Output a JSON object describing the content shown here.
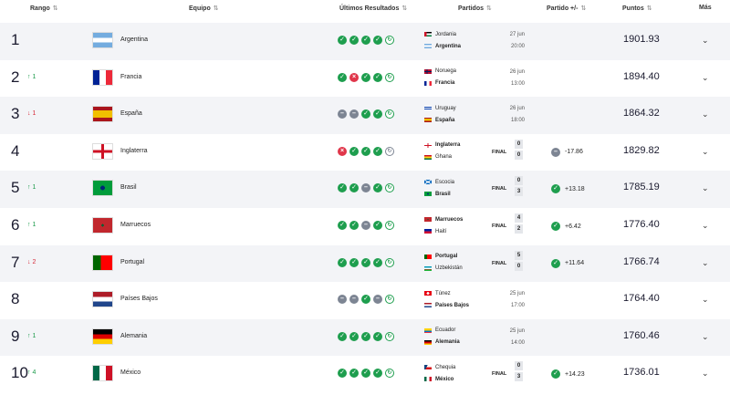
{
  "header": {
    "rank": "Rango",
    "team": "Equipo",
    "results": "Últimos Resultados",
    "matches": "Partidos",
    "delta": "Partido +/-",
    "points": "Puntos",
    "more": "Más",
    "sort_icon": "⇅"
  },
  "more_icon": "⌄",
  "rows": [
    {
      "rank": "1",
      "move": "",
      "dir": "",
      "team": "Argentina",
      "flag": "argentina",
      "results": [
        "W",
        "W",
        "W",
        "W",
        "N"
      ],
      "m1": {
        "name": "Jordania",
        "flag": "jordan",
        "bold": false
      },
      "m2": {
        "name": "Argentina",
        "flag": "argentina",
        "bold": true
      },
      "date": "27 jun",
      "time": "20:00",
      "final": "",
      "s1": "",
      "s2": "",
      "delta": "",
      "delta_type": "",
      "points": "1901.93"
    },
    {
      "rank": "2",
      "move": "↑ 1",
      "dir": "up",
      "team": "Francia",
      "flag": "france",
      "results": [
        "W",
        "L",
        "W",
        "W",
        "N"
      ],
      "m1": {
        "name": "Noruega",
        "flag": "norway",
        "bold": false
      },
      "m2": {
        "name": "Francia",
        "flag": "france",
        "bold": true
      },
      "date": "26 jun",
      "time": "13:00",
      "final": "",
      "s1": "",
      "s2": "",
      "delta": "",
      "delta_type": "",
      "points": "1894.40"
    },
    {
      "rank": "3",
      "move": "↓ 1",
      "dir": "down",
      "team": "España",
      "flag": "spain",
      "results": [
        "D",
        "D",
        "W",
        "W",
        "N"
      ],
      "m1": {
        "name": "Uruguay",
        "flag": "uruguay",
        "bold": false
      },
      "m2": {
        "name": "España",
        "flag": "spain",
        "bold": true
      },
      "date": "26 jun",
      "time": "18:00",
      "final": "",
      "s1": "",
      "s2": "",
      "delta": "",
      "delta_type": "",
      "points": "1864.32"
    },
    {
      "rank": "4",
      "move": "",
      "dir": "",
      "team": "Inglaterra",
      "flag": "england",
      "results": [
        "L",
        "W",
        "W",
        "W",
        "NG"
      ],
      "m1": {
        "name": "Inglaterra",
        "flag": "england",
        "bold": true
      },
      "m2": {
        "name": "Ghana",
        "flag": "ghana",
        "bold": false
      },
      "date": "",
      "time": "",
      "final": "FINAL",
      "s1": "0",
      "s2": "0",
      "delta": "-17.86",
      "delta_type": "D",
      "points": "1829.82"
    },
    {
      "rank": "5",
      "move": "↑ 1",
      "dir": "up",
      "team": "Brasil",
      "flag": "brazil",
      "results": [
        "W",
        "W",
        "D",
        "W",
        "N"
      ],
      "m1": {
        "name": "Escocia",
        "flag": "scotland",
        "bold": false
      },
      "m2": {
        "name": "Brasil",
        "flag": "brazil",
        "bold": true
      },
      "date": "",
      "time": "",
      "final": "FINAL",
      "s1": "0",
      "s2": "3",
      "delta": "+13.18",
      "delta_type": "W",
      "points": "1785.19"
    },
    {
      "rank": "6",
      "move": "↑ 1",
      "dir": "up",
      "team": "Marruecos",
      "flag": "morocco",
      "results": [
        "W",
        "W",
        "D",
        "W",
        "N"
      ],
      "m1": {
        "name": "Marruecos",
        "flag": "morocco",
        "bold": true
      },
      "m2": {
        "name": "Haití",
        "flag": "haiti",
        "bold": false
      },
      "date": "",
      "time": "",
      "final": "FINAL",
      "s1": "4",
      "s2": "2",
      "delta": "+6.42",
      "delta_type": "W",
      "points": "1776.40"
    },
    {
      "rank": "7",
      "move": "↓ 2",
      "dir": "down",
      "team": "Portugal",
      "flag": "portugal",
      "results": [
        "W",
        "W",
        "W",
        "W",
        "N"
      ],
      "m1": {
        "name": "Portugal",
        "flag": "portugal",
        "bold": true
      },
      "m2": {
        "name": "Uzbekistán",
        "flag": "uzbekistan",
        "bold": false
      },
      "date": "",
      "time": "",
      "final": "FINAL",
      "s1": "5",
      "s2": "0",
      "delta": "+11.64",
      "delta_type": "W",
      "points": "1766.74"
    },
    {
      "rank": "8",
      "move": "",
      "dir": "",
      "team": "Países Bajos",
      "flag": "netherlands",
      "results": [
        "D",
        "D",
        "W",
        "D",
        "N"
      ],
      "m1": {
        "name": "Túnez",
        "flag": "tunisia",
        "bold": false
      },
      "m2": {
        "name": "Países Bajos",
        "flag": "netherlands",
        "bold": true
      },
      "date": "25 jun",
      "time": "17:00",
      "final": "",
      "s1": "",
      "s2": "",
      "delta": "",
      "delta_type": "",
      "points": "1764.40"
    },
    {
      "rank": "9",
      "move": "↑ 1",
      "dir": "up",
      "team": "Alemania",
      "flag": "germany",
      "results": [
        "W",
        "W",
        "W",
        "W",
        "N"
      ],
      "m1": {
        "name": "Ecuador",
        "flag": "ecuador",
        "bold": false
      },
      "m2": {
        "name": "Alemania",
        "flag": "germany",
        "bold": true
      },
      "date": "25 jun",
      "time": "14:00",
      "final": "",
      "s1": "",
      "s2": "",
      "delta": "",
      "delta_type": "",
      "points": "1760.46"
    },
    {
      "rank": "10",
      "move": "↑ 4",
      "dir": "up",
      "team": "México",
      "flag": "mexico",
      "results": [
        "W",
        "W",
        "W",
        "W",
        "N"
      ],
      "m1": {
        "name": "Chequia",
        "flag": "czechia",
        "bold": false
      },
      "m2": {
        "name": "México",
        "flag": "mexico",
        "bold": true
      },
      "date": "",
      "time": "",
      "final": "FINAL",
      "s1": "0",
      "s2": "3",
      "delta": "+14.23",
      "delta_type": "W",
      "points": "1736.01"
    }
  ]
}
